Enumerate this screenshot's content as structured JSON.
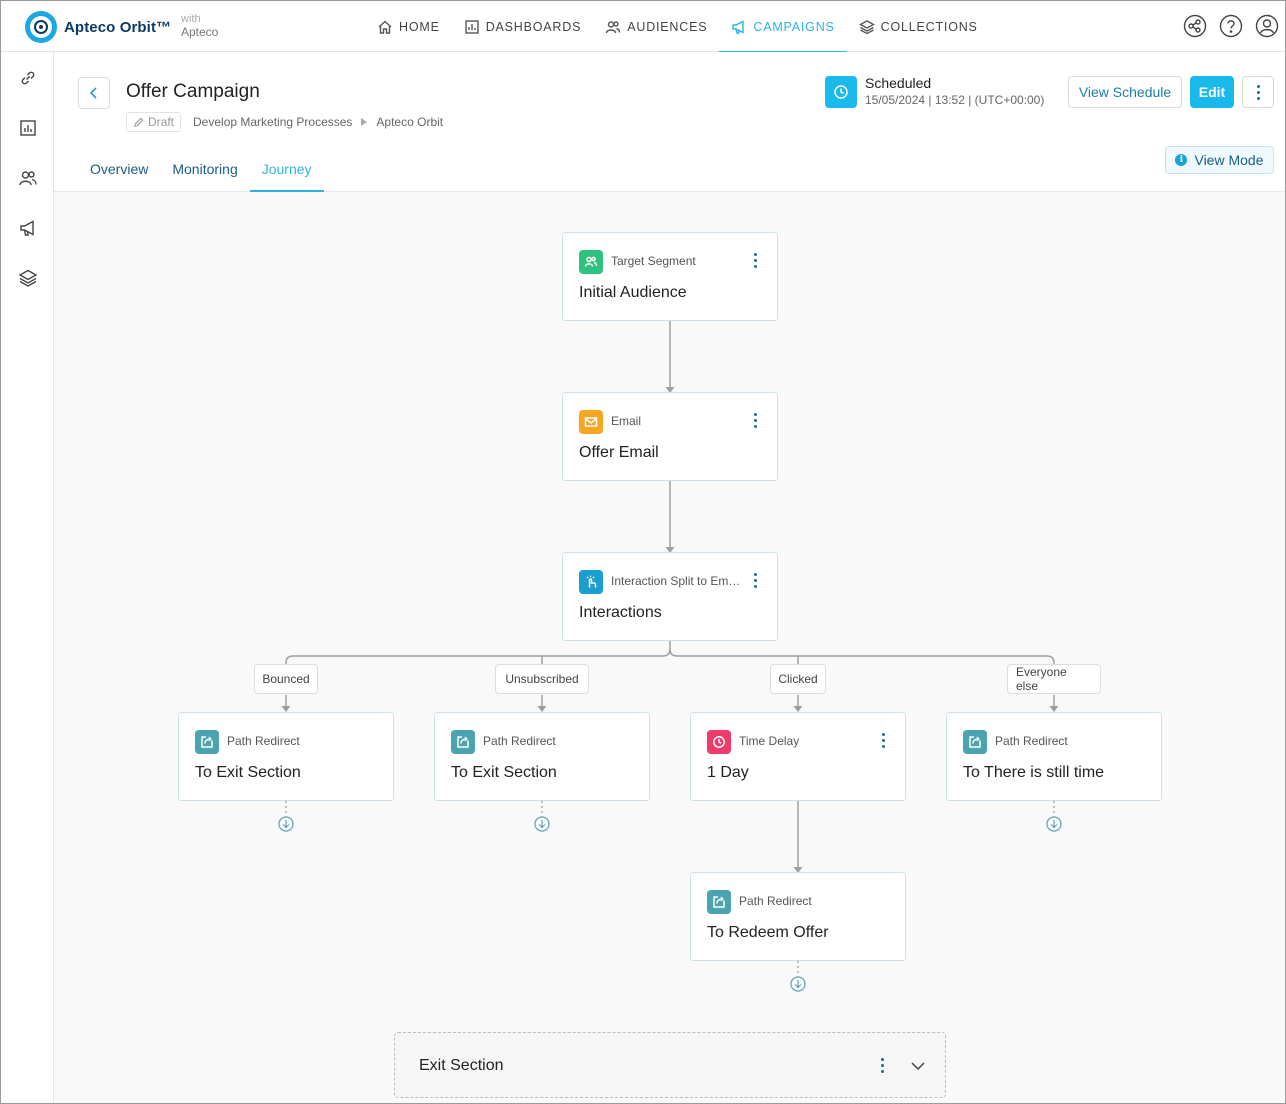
{
  "brand": {
    "name": "Apteco Orbit™",
    "with_label": "with",
    "with_brand": "Apteco"
  },
  "nav": {
    "items": [
      {
        "label": "HOME",
        "icon": "home-icon",
        "active": false
      },
      {
        "label": "DASHBOARDS",
        "icon": "dashboard-icon",
        "active": false
      },
      {
        "label": "AUDIENCES",
        "icon": "audiences-icon",
        "active": false
      },
      {
        "label": "CAMPAIGNS",
        "icon": "megaphone-icon",
        "active": true
      },
      {
        "label": "COLLECTIONS",
        "icon": "layers-icon",
        "active": false
      }
    ],
    "right_icons": [
      "share-icon",
      "help-icon",
      "user-icon"
    ],
    "accent_color": "#2bb4e4"
  },
  "rail": {
    "icons": [
      "link-icon",
      "dashboard-icon",
      "audiences-icon",
      "megaphone-icon",
      "layers-icon"
    ]
  },
  "header": {
    "title": "Offer Campaign",
    "status_pill": "Draft",
    "breadcrumb": [
      "Develop Marketing Processes",
      "Apteco Orbit"
    ],
    "schedule": {
      "status": "Scheduled",
      "detail": "15/05/2024 | 13:52 | (UTC+00:00)"
    },
    "view_schedule_label": "View Schedule",
    "edit_label": "Edit",
    "tabs": [
      {
        "label": "Overview",
        "active": false
      },
      {
        "label": "Monitoring",
        "active": false
      },
      {
        "label": "Journey",
        "active": true
      }
    ],
    "view_mode_label": "View Mode"
  },
  "journey": {
    "nodes": {
      "target": {
        "type": "Target Segment",
        "name": "Initial Audience",
        "color": "#2ec27e"
      },
      "email": {
        "type": "Email",
        "name": "Offer Email",
        "color": "#f5a623"
      },
      "split": {
        "type": "Interaction Split to Em…",
        "name": "Interactions",
        "color": "#1a9fd0"
      },
      "redirect1": {
        "type": "Path Redirect",
        "name": "To Exit Section",
        "color": "#4aa3ad"
      },
      "redirect2": {
        "type": "Path Redirect",
        "name": "To Exit Section",
        "color": "#4aa3ad"
      },
      "delay": {
        "type": "Time Delay",
        "name": "1 Day",
        "color": "#ef3b6b"
      },
      "redirect3": {
        "type": "Path Redirect",
        "name": "To There is still time",
        "color": "#4aa3ad"
      },
      "redirect4": {
        "type": "Path Redirect",
        "name": "To Redeem Offer",
        "color": "#4aa3ad"
      }
    },
    "branches": [
      "Bounced",
      "Unsubscribed",
      "Clicked",
      "Everyone else"
    ],
    "exit_section": "Exit Section"
  }
}
